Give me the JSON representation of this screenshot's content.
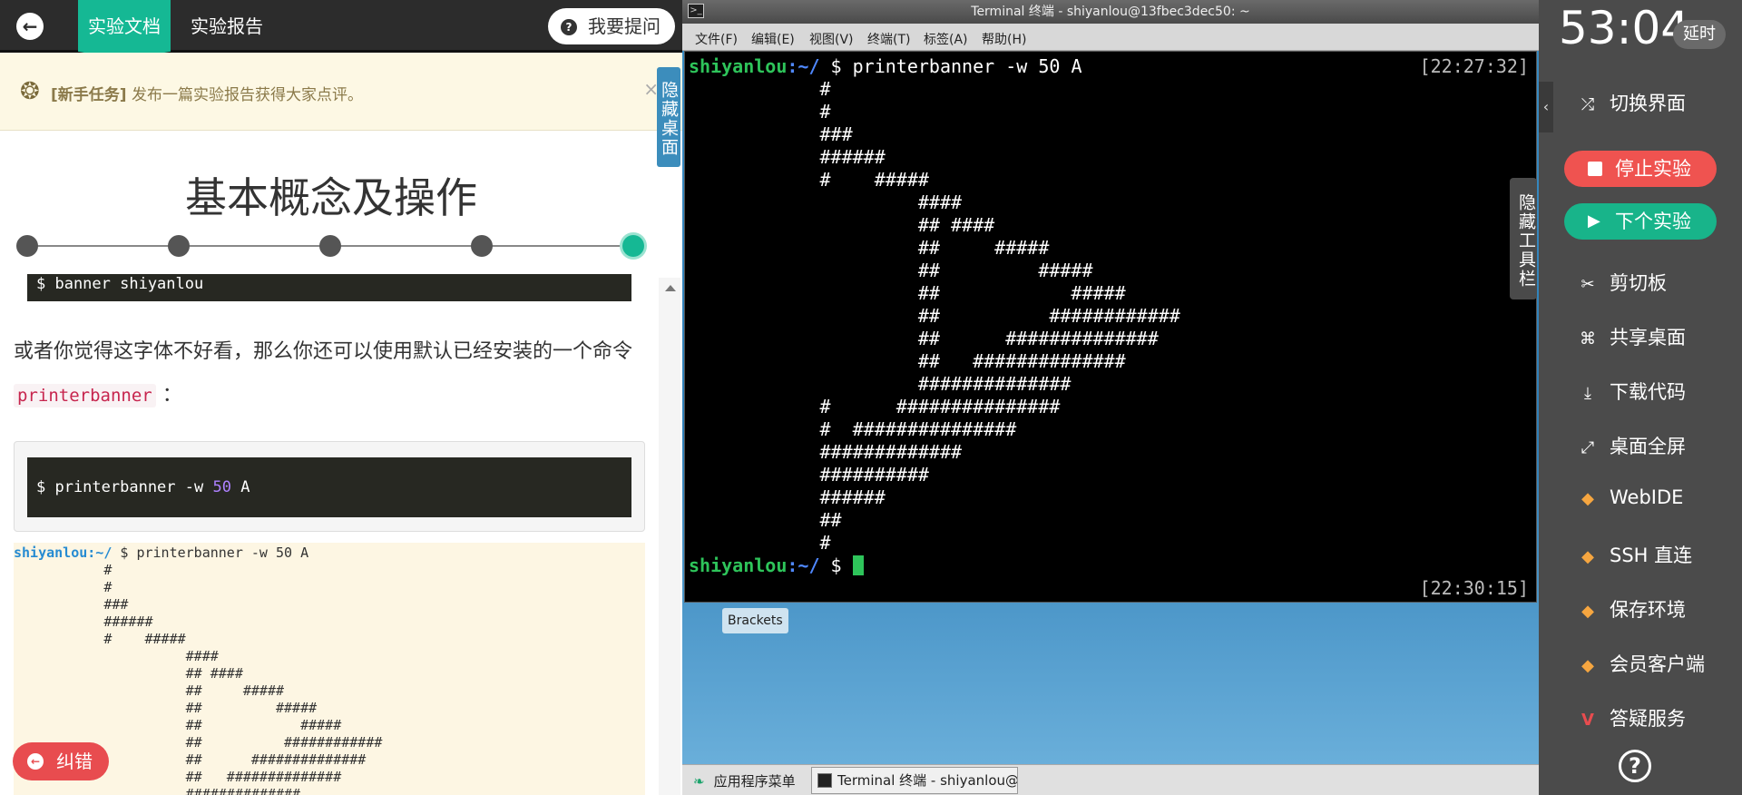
{
  "left_panel": {
    "back_icon": "arrow-left-icon",
    "tabs": [
      {
        "label": "实验文档",
        "active": true
      },
      {
        "label": "实验报告",
        "active": false
      }
    ],
    "ask_button": "我要提问",
    "notice": {
      "tag": "[新手任务]",
      "text": " 发布一篇实验报告获得大家点评。",
      "close": "×"
    },
    "hide_desktop": "隐藏桌面",
    "title": "基本概念及操作",
    "steps": {
      "count": 5,
      "active_index": 4
    },
    "code1": "$ banner shiyanlou",
    "para_before": "或者你觉得这字体不好看，那么你还可以使用默认已经安装的一个命令 ",
    "para_code": "printerbanner",
    "para_after": " ：",
    "code2": {
      "prefix": "$ printerbanner -w ",
      "num": "50",
      "suffix": " A"
    },
    "sample": {
      "user": "shiyanlou",
      "path": ":~/",
      "command": " $ printerbanner -w 50 A",
      "lines": [
        "           #",
        "           #",
        "           ###",
        "           ######",
        "           #    #####",
        "                     ####",
        "                     ## ####",
        "                     ##     #####",
        "                     ##         #####",
        "                     ##            #####",
        "                     ##          ############",
        "                     ##      ##############",
        "                     ##   ##############",
        "                     ##############"
      ]
    },
    "fix_button": "纠错"
  },
  "terminal": {
    "title": "Terminal 终端 - shiyanlou@13fbec3dec50: ~",
    "menu": [
      "文件(F)",
      "编辑(E)",
      "视图(V)",
      "终端(T)",
      "标签(A)",
      "帮助(H)"
    ],
    "prompt_user": "shiyanlou",
    "prompt_path": ":~/",
    "command": " $ printerbanner -w 50 A",
    "timestamp1": "[22:27:32]",
    "output": [
      "            #",
      "            #",
      "            ###",
      "            ######",
      "            #    #####",
      "                     ####",
      "                     ## ####",
      "                     ##     #####",
      "                     ##         #####",
      "                     ##            #####",
      "                     ##          ############",
      "                     ##      ##############",
      "                     ##   ##############",
      "                     ##############",
      "            #      ###############",
      "            #  ###############",
      "            #############",
      "            ##########",
      "            ######",
      "            ##",
      "            #"
    ],
    "prompt2": " $ ",
    "timestamp2": "[22:30:15]",
    "hide_toolbar": "隐藏工具栏"
  },
  "desktop": {
    "brackets_label": "Brackets",
    "app_menu": "应用程序菜单",
    "taskbar_item": "Terminal 终端 - shiyanlou@…"
  },
  "toolbar": {
    "timer": "53:04",
    "extend": "延时",
    "collapse_icon": "chevron-left-icon",
    "switch": "切换界面",
    "stop": "停止实验",
    "next": "下个实验",
    "items": [
      {
        "label": "剪切板",
        "icon": "scissors-icon"
      },
      {
        "label": "共享桌面",
        "icon": "share-icon"
      },
      {
        "label": "下载代码",
        "icon": "download-icon"
      },
      {
        "label": "桌面全屏",
        "icon": "fullscreen-icon"
      },
      {
        "label": "WebIDE",
        "icon": "gem-icon"
      },
      {
        "label": "SSH 直连",
        "icon": "gem-icon"
      },
      {
        "label": "保存环境",
        "icon": "gem-icon"
      },
      {
        "label": "会员客户端",
        "icon": "gem-icon"
      },
      {
        "label": "答疑服务",
        "icon": "v-icon"
      }
    ]
  }
}
